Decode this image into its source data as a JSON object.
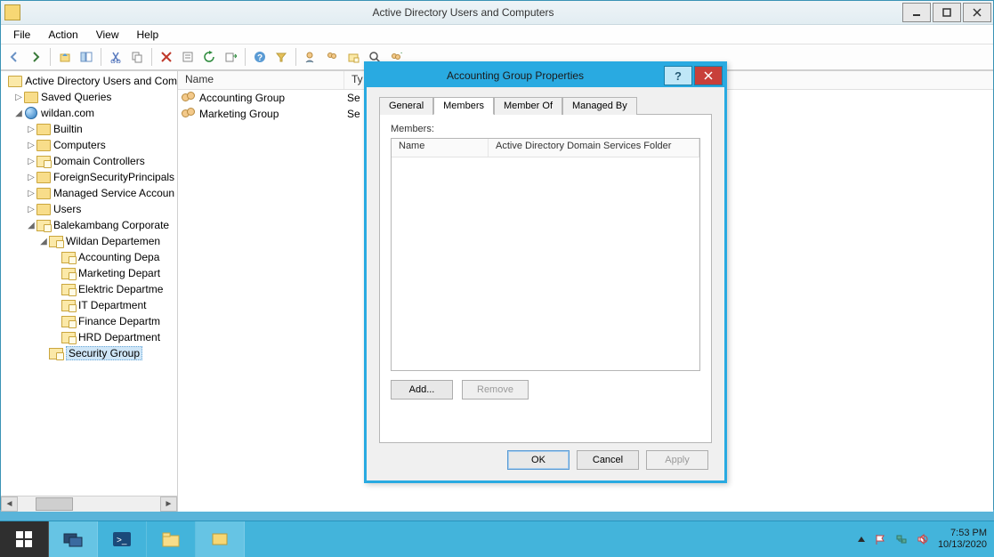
{
  "window": {
    "title": "Active Directory Users and Computers"
  },
  "menu": {
    "file": "File",
    "action": "Action",
    "view": "View",
    "help": "Help"
  },
  "tree": {
    "root": "Active Directory Users and Com",
    "saved_queries": "Saved Queries",
    "domain": "wildan.com",
    "builtin": "Builtin",
    "computers": "Computers",
    "domain_controllers": "Domain Controllers",
    "fsp": "ForeignSecurityPrincipals",
    "msa": "Managed Service Accoun",
    "users": "Users",
    "balekambang": "Balekambang Corporate",
    "wildan_dept": "Wildan Departemen",
    "dept_accounting": "Accounting Depa",
    "dept_marketing": "Marketing Depart",
    "dept_elektric": "Elektric Departme",
    "dept_it": "IT Department",
    "dept_finance": "Finance Departm",
    "dept_hrd": "HRD Department",
    "security_group": "Security Group"
  },
  "list": {
    "col_name": "Name",
    "col_type": "Ty",
    "rows": [
      {
        "name": "Accounting Group",
        "type": "Se"
      },
      {
        "name": "Marketing Group",
        "type": "Se"
      }
    ]
  },
  "dialog": {
    "title": "Accounting Group Properties",
    "tabs": {
      "general": "General",
      "members": "Members",
      "member_of": "Member Of",
      "managed_by": "Managed By"
    },
    "members_label": "Members:",
    "col_name": "Name",
    "col_folder": "Active Directory Domain Services Folder",
    "add": "Add...",
    "remove": "Remove",
    "ok": "OK",
    "cancel": "Cancel",
    "apply": "Apply"
  },
  "tray": {
    "time": "7:53 PM",
    "date": "10/13/2020"
  }
}
